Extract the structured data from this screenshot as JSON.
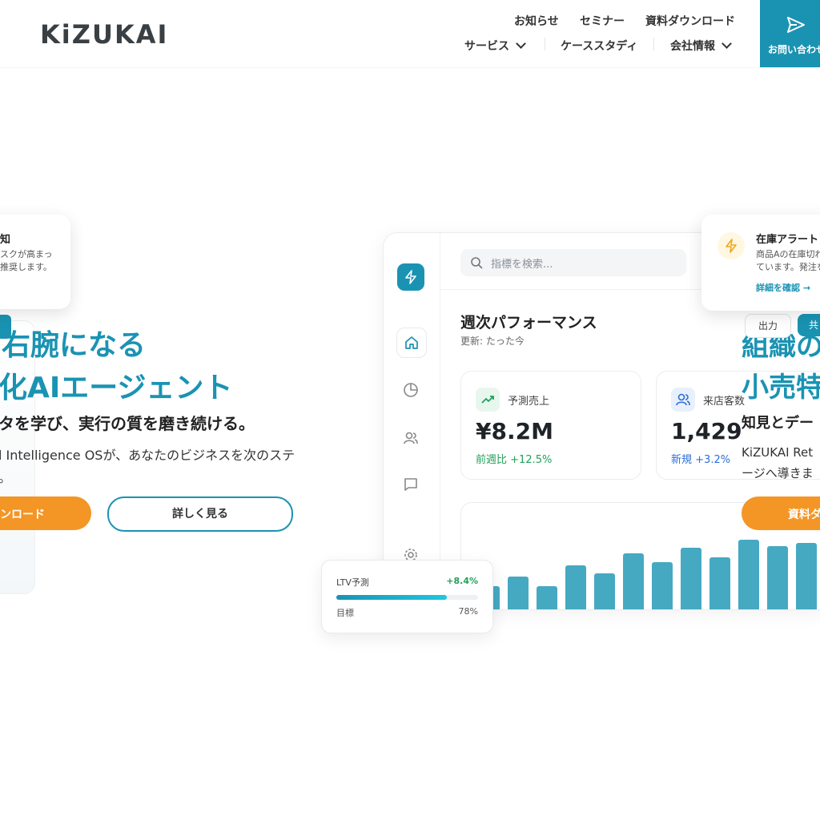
{
  "header": {
    "logo": "KiZUKAI",
    "top_links": [
      "お知らせ",
      "セミナー",
      "資料ダウンロード"
    ],
    "main_nav": [
      "サービス",
      "ケーススタディ",
      "会社情報"
    ],
    "contact_label": "お問い合わせ"
  },
  "left_card": {
    "title": "知",
    "body_line1": "スクが高まっ",
    "body_line2": "推奨します。"
  },
  "hero": {
    "headline_line1": "右腕になる",
    "headline_line2": "化AIエージェント",
    "subheadline": "タを学び、実行の質を磨き続ける。",
    "description_line1": "l Intelligence OSが、あなたのビジネスを次のステ",
    "description_line2": "。",
    "download_button": "ンロード",
    "details_button": "詳しく見る"
  },
  "dashboard": {
    "search_placeholder": "指標を検索...",
    "title": "週次パフォーマンス",
    "updated": "更新: たった今",
    "export_button": "出力",
    "share_button": "共",
    "stats": [
      {
        "label": "予測売上",
        "value": "¥8.2M",
        "change_prefix": "前週比",
        "change": "+12.5%",
        "color": "#22a05a"
      },
      {
        "label": "来店客数",
        "value": "1,429",
        "change_prefix": "新規",
        "change": "+3.2%",
        "color": "#2b6fd6"
      }
    ],
    "chart_bars": [
      0.3,
      0.4,
      0.3,
      0.52,
      0.43,
      0.64,
      0.55,
      0.7,
      0.6,
      0.78,
      0.72,
      0.75,
      0.78,
      0.7
    ]
  },
  "overlay_right": {
    "headline_line1": "組織の",
    "headline_line2": "小売特",
    "subheadline": "知見とデー",
    "description_line1": "KiZUKAI Ret",
    "description_line2": "ージへ導きま",
    "button": "資料ダ"
  },
  "alert": {
    "title": "在庫アラート",
    "body_line1": "商品Aの在庫切れ",
    "body_line2": "ています。発注を",
    "link": "詳細を確認 →"
  },
  "ltv_card": {
    "label": "LTV予測",
    "change": "+8.4%",
    "target_label": "目標",
    "target_value": "78%",
    "progress": 0.78
  },
  "colors": {
    "brand": "#1a93b3",
    "accent": "#f39625",
    "positive": "#22a05a",
    "info": "#2b6fd6"
  }
}
